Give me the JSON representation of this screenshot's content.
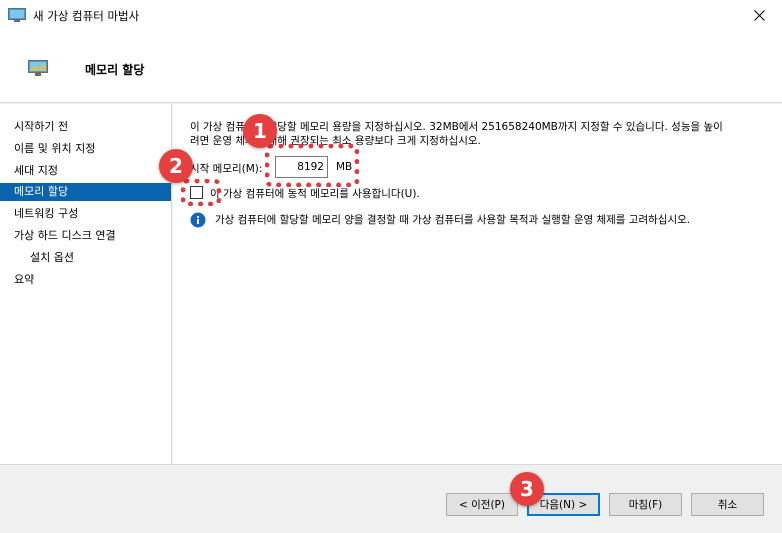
{
  "window": {
    "title": "새 가상 컴퓨터 마법사",
    "app_icon": "monitor-icon",
    "close_icon": "close-icon"
  },
  "header": {
    "title": "메모리 할당",
    "icon": "monitor-icon"
  },
  "sidebar": {
    "items": [
      {
        "label": "시작하기 전",
        "active": false
      },
      {
        "label": "이름 및 위치 지정",
        "active": false
      },
      {
        "label": "세대 지정",
        "active": false
      },
      {
        "label": "메모리 할당",
        "active": true
      },
      {
        "label": "네트워킹 구성",
        "active": false
      },
      {
        "label": "가상 하드 디스크 연결",
        "active": false
      },
      {
        "label": "설치 옵션",
        "active": false,
        "sub": true
      },
      {
        "label": "요약",
        "active": false
      }
    ]
  },
  "content": {
    "description_line1": "이 가상 컴퓨터에 할당할 메모리 용량을 지정하십시오. 32MB에서 251658240MB까지 지정할 수 있습니다. 성능을 높이",
    "description_line2": "려면 운영 체제에 대해 권장되는 최소 용량보다 크게 지정하십시오.",
    "startup_memory_label": "시작 메모리(M):",
    "startup_memory_value": "8192",
    "startup_memory_unit": "MB",
    "dynamic_memory_label": "이 가상 컴퓨터에 동적 메모리를 사용합니다(U).",
    "dynamic_memory_checked": false,
    "info_text": "가상 컴퓨터에 할당할 메모리 양을 결정할 때 가상 컴퓨터를 사용할 목적과 실행할 운영 체제를 고려하십시오."
  },
  "footer": {
    "prev_label": "< 이전(P)",
    "next_label": "다음(N) >",
    "finish_label": "마침(F)",
    "cancel_label": "취소"
  },
  "annotations": {
    "badge_1": "1",
    "badge_2": "2",
    "badge_3": "3",
    "color": "#e63f3f"
  },
  "colors": {
    "selection": "#0a64ad",
    "info": "#1565c0"
  }
}
